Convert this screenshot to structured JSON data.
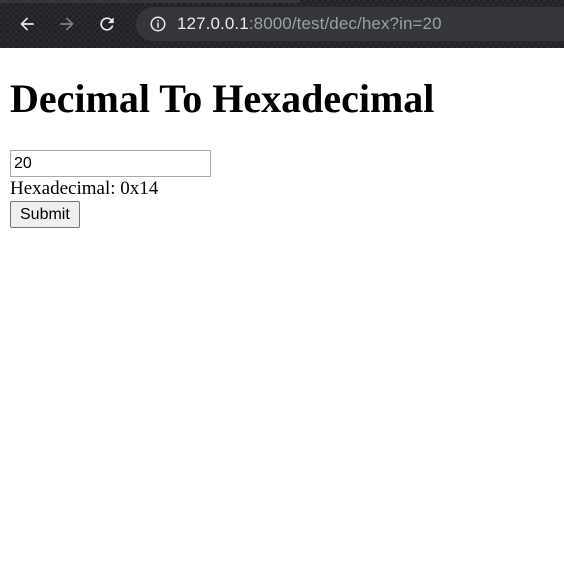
{
  "browser": {
    "url_host": "127.0.0.1",
    "url_path": ":8000/test/dec/hex?in=20"
  },
  "page": {
    "title": "Decimal To Hexadecimal",
    "input_value": "20",
    "result_text": "Hexadecimal: 0x14",
    "submit_label": "Submit"
  }
}
